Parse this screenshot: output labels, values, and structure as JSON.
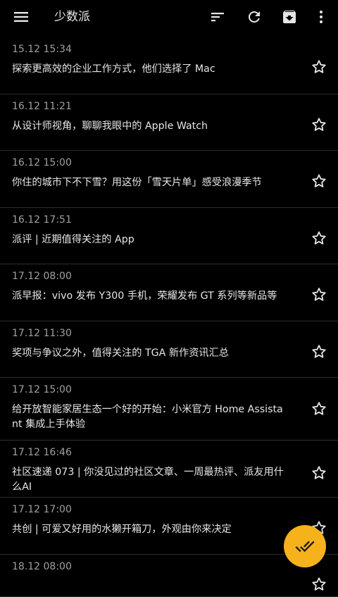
{
  "app_bar": {
    "title": "少数派",
    "menu_icon": "menu-icon",
    "sort_icon": "sort-icon",
    "refresh_icon": "refresh-icon",
    "archive_icon": "archive-icon",
    "more_icon": "more-vert-icon"
  },
  "articles": [
    {
      "time": "15.12 15:34",
      "title": "探索更高效的企业工作方式，他们选择了 Mac"
    },
    {
      "time": "16.12 11:21",
      "title": "从设计师视角，聊聊我眼中的 Apple Watch"
    },
    {
      "time": "16.12 15:00",
      "title": "你住的城市下不下雪？用这份「雪天片单」感受浪漫季节"
    },
    {
      "time": "16.12 17:51",
      "title": "派评 | 近期值得关注的 App"
    },
    {
      "time": "17.12 08:00",
      "title": "派早报：vivo 发布 Y300 手机，荣耀发布 GT 系列等新品等"
    },
    {
      "time": "17.12 11:30",
      "title": "奖项与争议之外，值得关注的 TGA 新作资讯汇总"
    },
    {
      "time": "17.12 15:00",
      "title": "给开放智能家居生态一个好的开始：小米官方 Home Assistant 集成上手体验"
    },
    {
      "time": "17.12 16:46",
      "title": "社区速递 073 | 你没见过的社区文章、一周最热评、派友用什么AI"
    },
    {
      "time": "17.12 17:00",
      "title": "共创 | 可爱又好用的水獭开箱刀，外观由你来决定"
    },
    {
      "time": "18.12 08:00",
      "title": ""
    }
  ],
  "fab": {
    "icon": "done-all-icon"
  },
  "colors": {
    "background": "#000000",
    "text_primary": "#e6e6e6",
    "text_secondary": "#a0a0a0",
    "divider": "#2e2e2e",
    "fab": "#f6b21b"
  }
}
